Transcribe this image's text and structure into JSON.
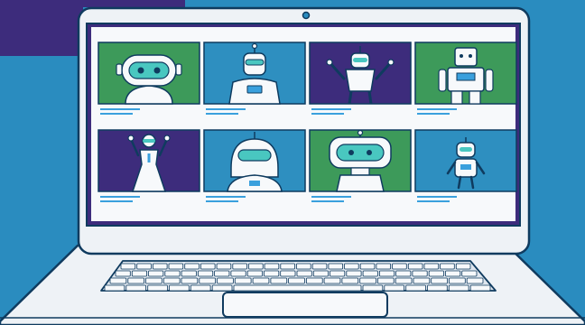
{
  "colors": {
    "background": "#2a8cbf",
    "corner_panel": "#3d2c7c",
    "outline": "#0f3b5f",
    "laptop_body": "#eef2f6",
    "screen_bg": "#f7f9fb",
    "green": "#3d9a5a",
    "blue": "#2e8fc0",
    "purple": "#3d2c7c",
    "accent_blue": "#3aa0dd",
    "visor": "#49c7c0"
  },
  "tiles": [
    {
      "row": 0,
      "col": 0,
      "bg": "green",
      "robot": "round-head-robot"
    },
    {
      "row": 0,
      "col": 1,
      "bg": "blue",
      "robot": "antenna-robot"
    },
    {
      "row": 0,
      "col": 2,
      "bg": "purple",
      "robot": "arms-up-robot"
    },
    {
      "row": 0,
      "col": 3,
      "bg": "green",
      "robot": "boxy-robot"
    },
    {
      "row": 1,
      "col": 0,
      "bg": "purple",
      "robot": "waving-android"
    },
    {
      "row": 1,
      "col": 1,
      "bg": "blue",
      "robot": "helmet-robot"
    },
    {
      "row": 1,
      "col": 2,
      "bg": "green",
      "robot": "wide-visor-robot"
    },
    {
      "row": 1,
      "col": 3,
      "bg": "blue",
      "robot": "small-robot"
    }
  ]
}
